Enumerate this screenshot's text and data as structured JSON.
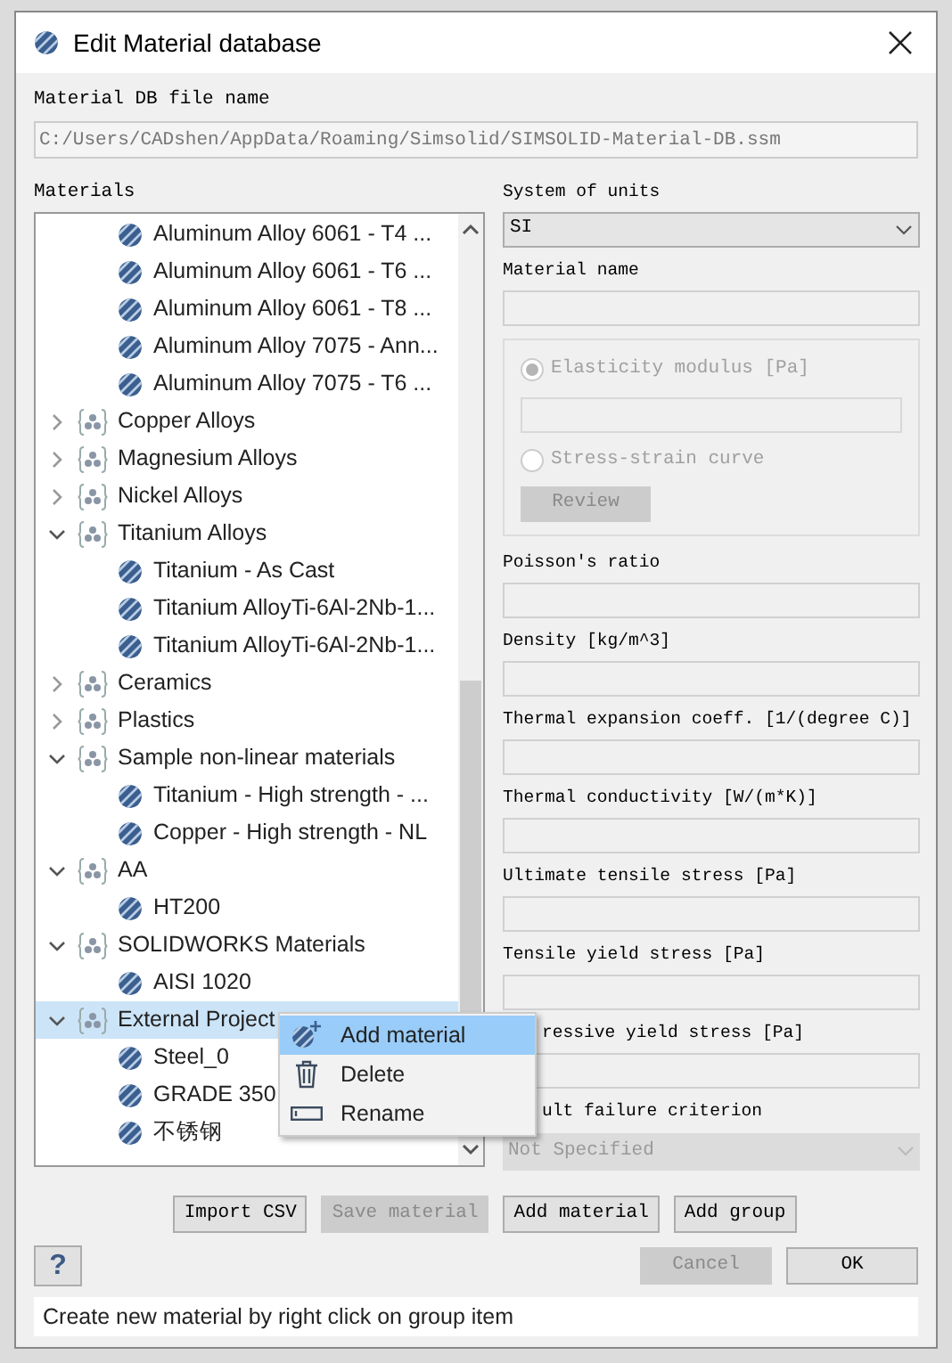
{
  "window": {
    "title": "Edit Material database"
  },
  "db_file": {
    "label": "Material DB file name",
    "value": "C:/Users/CADshen/AppData/Roaming/Simsolid/SIMSOLID-Material-DB.ssm"
  },
  "materials": {
    "label": "Materials",
    "continued_items": [
      {
        "label": "Aluminum Alloy 6061 - T4 ..."
      },
      {
        "label": "Aluminum Alloy 6061 - T6 ..."
      },
      {
        "label": "Aluminum Alloy 6061 - T8 ..."
      },
      {
        "label": "Aluminum Alloy 7075 - Ann..."
      },
      {
        "label": "Aluminum Alloy 7075 - T6 ..."
      }
    ],
    "groups": [
      {
        "label": "Copper Alloys",
        "expanded": false,
        "selected": false
      },
      {
        "label": "Magnesium Alloys",
        "expanded": false,
        "selected": false
      },
      {
        "label": "Nickel Alloys",
        "expanded": false,
        "selected": false
      },
      {
        "label": "Titanium Alloys",
        "expanded": true,
        "selected": false,
        "children": [
          {
            "label": "Titanium - As Cast"
          },
          {
            "label": "Titanium AlloyTi-6Al-2Nb-1..."
          },
          {
            "label": "Titanium AlloyTi-6Al-2Nb-1..."
          }
        ]
      },
      {
        "label": "Ceramics",
        "expanded": false,
        "selected": false
      },
      {
        "label": "Plastics",
        "expanded": false,
        "selected": false
      },
      {
        "label": "Sample non-linear materials",
        "expanded": true,
        "selected": false,
        "children": [
          {
            "label": "Titanium - High strength - ..."
          },
          {
            "label": "Copper - High strength - NL"
          }
        ]
      },
      {
        "label": "AA",
        "expanded": true,
        "selected": false,
        "children": [
          {
            "label": "HT200"
          }
        ]
      },
      {
        "label": "SOLIDWORKS Materials",
        "expanded": true,
        "selected": false,
        "children": [
          {
            "label": "AISI 1020"
          }
        ]
      },
      {
        "label": "External Project",
        "expanded": true,
        "selected": true,
        "children": [
          {
            "label": "Steel_0"
          },
          {
            "label": "GRADE 350"
          },
          {
            "label": "不锈钢"
          }
        ]
      }
    ]
  },
  "context_menu": [
    {
      "label": "Add material",
      "kind": "add",
      "selected": true
    },
    {
      "label": "Delete",
      "kind": "delete",
      "selected": false
    },
    {
      "label": "Rename",
      "kind": "rename",
      "selected": false
    }
  ],
  "units": {
    "label": "System of units",
    "value": "SI"
  },
  "material_name": {
    "label": "Material name"
  },
  "elasticity": {
    "options": [
      {
        "label": "Elasticity modulus [Pa]",
        "checked": true,
        "kind": "with_field"
      },
      {
        "label": "Stress-strain curve",
        "checked": false,
        "kind": "with_button"
      }
    ],
    "review_button": {
      "label": "Review",
      "disabled": true
    },
    "disabled": true
  },
  "properties": [
    {
      "label": "Poisson's ratio",
      "covered": false
    },
    {
      "label": "Density [kg/m^3]",
      "covered": false
    },
    {
      "label": "Thermal expansion coeff. [1/(degree C)]",
      "covered": false
    },
    {
      "label": "Thermal conductivity [W/(m*K)]",
      "covered": false
    },
    {
      "label": "Ultimate tensile stress [Pa]",
      "covered": false
    },
    {
      "label": "Tensile yield stress [Pa]",
      "covered": false
    },
    {
      "label": "ressive yield stress [Pa]",
      "covered": true
    }
  ],
  "fault": {
    "label": "ult failure criterion",
    "value": "Not Specified",
    "disabled": true,
    "covered": true
  },
  "buttons": [
    {
      "label": "Import CSV",
      "disabled": false
    },
    {
      "label": "Save material",
      "disabled": true
    },
    {
      "label": "Add material",
      "disabled": false
    },
    {
      "label": "Add group",
      "disabled": false
    }
  ],
  "help_button": {
    "label": "?"
  },
  "dialog_buttons": [
    {
      "label": "Cancel",
      "disabled": true
    },
    {
      "label": "OK",
      "disabled": false
    }
  ],
  "status": "Create new material by right click on group item"
}
